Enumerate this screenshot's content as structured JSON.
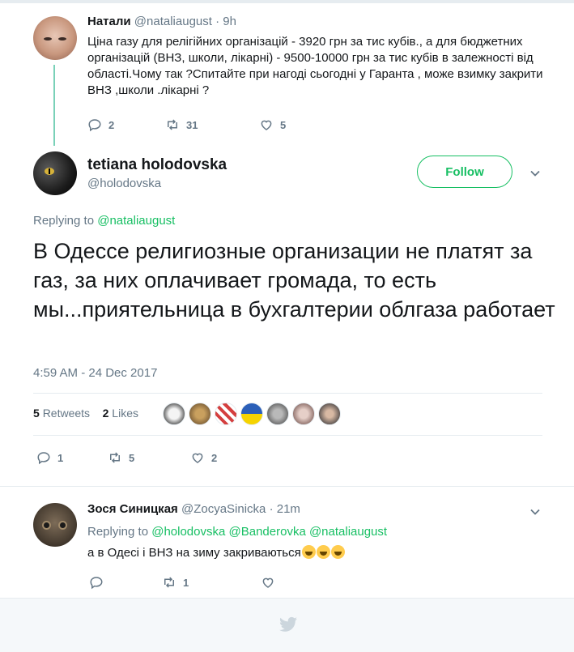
{
  "parent_tweet": {
    "name": "Натали",
    "handle": "@nataliaugust",
    "time": "· 9h",
    "text": "Ціна газу для релігійних організацій - 3920 грн за тис кубів., а для бюджетних організацій (ВНЗ, школи, лікарні) - 9500-10000 грн за тис кубів в залежності від області.Чому так ?Спитайте при нагоді сьогодні у Гаранта , може взимку закрити ВНЗ ,школи .лікарні ?",
    "replies": "2",
    "retweets": "31",
    "likes": "5"
  },
  "main_tweet": {
    "name": "tetiana holodovska",
    "handle": "@holodovska",
    "follow_label": "Follow",
    "replying_prefix": "Replying to",
    "replying_to": "@nataliaugust",
    "text": "В Одессе религиозные организации не платят за газ, за них оплачивает громада, то есть мы...приятельница в бухгалтерии облгаза работает",
    "timestamp": "4:59 AM - 24 Dec 2017",
    "retweet_count": "5",
    "retweet_label": "Retweets",
    "like_count": "2",
    "like_label": "Likes",
    "replies": "1",
    "retweets": "5",
    "likes": "2"
  },
  "reply_tweet": {
    "name": "Зося Синицкая",
    "handle": "@ZocyaSinicka",
    "time": "· 21m",
    "replying_prefix": "Replying to",
    "replying_to": "@holodovska @Banderovka @nataliaugust",
    "text": "а в Одесі і ВНЗ на зиму закриваються",
    "retweets": "1"
  },
  "colors": {
    "accent_green": "#17bf63",
    "link_blue": "#1da1f2",
    "muted": "#657786"
  },
  "icons": [
    "reply-icon",
    "retweet-icon",
    "like-icon",
    "chevron-down-icon",
    "twitter-bird-icon",
    "laughing-emoji-icon"
  ]
}
